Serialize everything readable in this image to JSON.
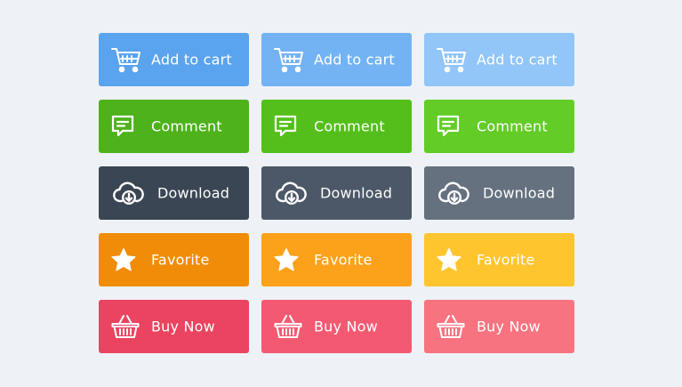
{
  "buttons": {
    "rows": [
      {
        "kind": "cart",
        "icon": "shopping-cart-icon",
        "variants": [
          {
            "label": "Add to cart",
            "color": "#5aa3ee"
          },
          {
            "label": "Add to cart",
            "color": "#73b3f4"
          },
          {
            "label": "Add to cart",
            "color": "#92c5f8"
          }
        ]
      },
      {
        "kind": "comment",
        "icon": "comment-icon",
        "variants": [
          {
            "label": "Comment",
            "color": "#4eb21b"
          },
          {
            "label": "Comment",
            "color": "#54bf1b"
          },
          {
            "label": "Comment",
            "color": "#63cc27"
          }
        ]
      },
      {
        "kind": "download",
        "icon": "cloud-download-icon",
        "variants": [
          {
            "label": "Download",
            "color": "#3a4653"
          },
          {
            "label": "Download",
            "color": "#4c5867"
          },
          {
            "label": "Download",
            "color": "#65717f"
          }
        ]
      },
      {
        "kind": "favorite",
        "icon": "star-icon",
        "variants": [
          {
            "label": "Favorite",
            "color": "#f08c08"
          },
          {
            "label": "Favorite",
            "color": "#fca11a"
          },
          {
            "label": "Favorite",
            "color": "#ffc52f"
          }
        ]
      },
      {
        "kind": "buy",
        "icon": "basket-icon",
        "variants": [
          {
            "label": "Buy Now",
            "color": "#ea4460"
          },
          {
            "label": "Buy Now",
            "color": "#f35a72"
          },
          {
            "label": "Buy Now",
            "color": "#f7737f"
          }
        ]
      }
    ]
  }
}
